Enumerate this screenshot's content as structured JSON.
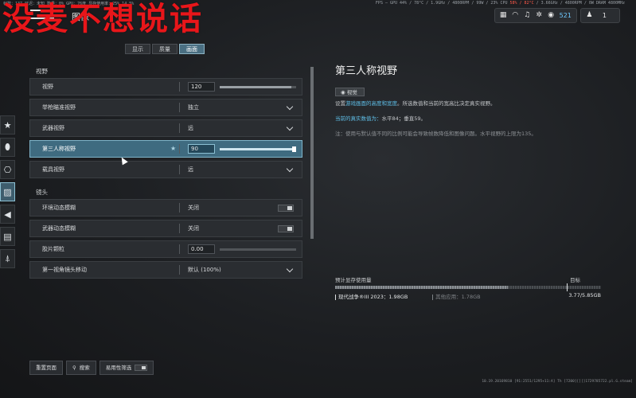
{
  "watermark": "没麦不想说话",
  "perf": {
    "left": "帧数：137  延迟：未知  数量：0%  GPU：76度  显存使用率：25%  14.5%",
    "right_pre": "FPS —  GPU 44% / 78°C / 1.9GHz / 4800RPM / 99W / 23%   CPU ",
    "right_hot": "58% / 82°C",
    "right_post": " / 3.66GHz / 4800RPM / 0W   DRAM 4800MHz"
  },
  "header": {
    "title": "图像"
  },
  "tabs": [
    "显示",
    "质量",
    "画面"
  ],
  "active_tab": "画面",
  "topbar": {
    "points": "521",
    "players": "1"
  },
  "sections": {
    "fov": {
      "label": "视野",
      "rows": [
        {
          "label": "视野",
          "value": "120",
          "slider": 0.94
        },
        {
          "label": "举枪瞄准视野",
          "value": "独立"
        },
        {
          "label": "武器视野",
          "value": "远"
        },
        {
          "label": "第三人称视野",
          "value": "90",
          "slider": 0.98
        },
        {
          "label": "载具视野",
          "value": "远"
        }
      ]
    },
    "camera": {
      "label": "镜头",
      "rows": [
        {
          "label": "环境动态模糊",
          "value": "关闭"
        },
        {
          "label": "武器动态模糊",
          "value": "关闭"
        },
        {
          "label": "胶片颗粒",
          "value": "0.00",
          "slider": 0.0
        },
        {
          "label": "第一视角镜头移动",
          "value": "默认 (100%)"
        }
      ]
    }
  },
  "info": {
    "title": "第三人称视野",
    "badge": "视觉",
    "desc_pre": "设置",
    "desc_link": "游戏画面的高度和宽度",
    "desc_post": "。所选数值和当前的宽高比决定真实视野。",
    "real_label": "当前的真实数值为：",
    "real_value": "水平84；垂直59。",
    "note": "注：使用与默认值不同的比例可能会导致帧数降低和图像问题。水平视野的上限为135。"
  },
  "memory": {
    "title": "预计显存使用量",
    "target_label": "目标",
    "game_label": "现代战争®III 2023：1.98GB",
    "other_label": "其他应用：1.78GB",
    "total": "3.77/5.85GB"
  },
  "bottom": {
    "reset": "重置页面",
    "search": "搜索",
    "accessibility": "易用性筛选"
  },
  "footer": "10.19.20169810 [91:2551/1295+11:A] Th [7200][][]1729785722.pl.G.steam]"
}
